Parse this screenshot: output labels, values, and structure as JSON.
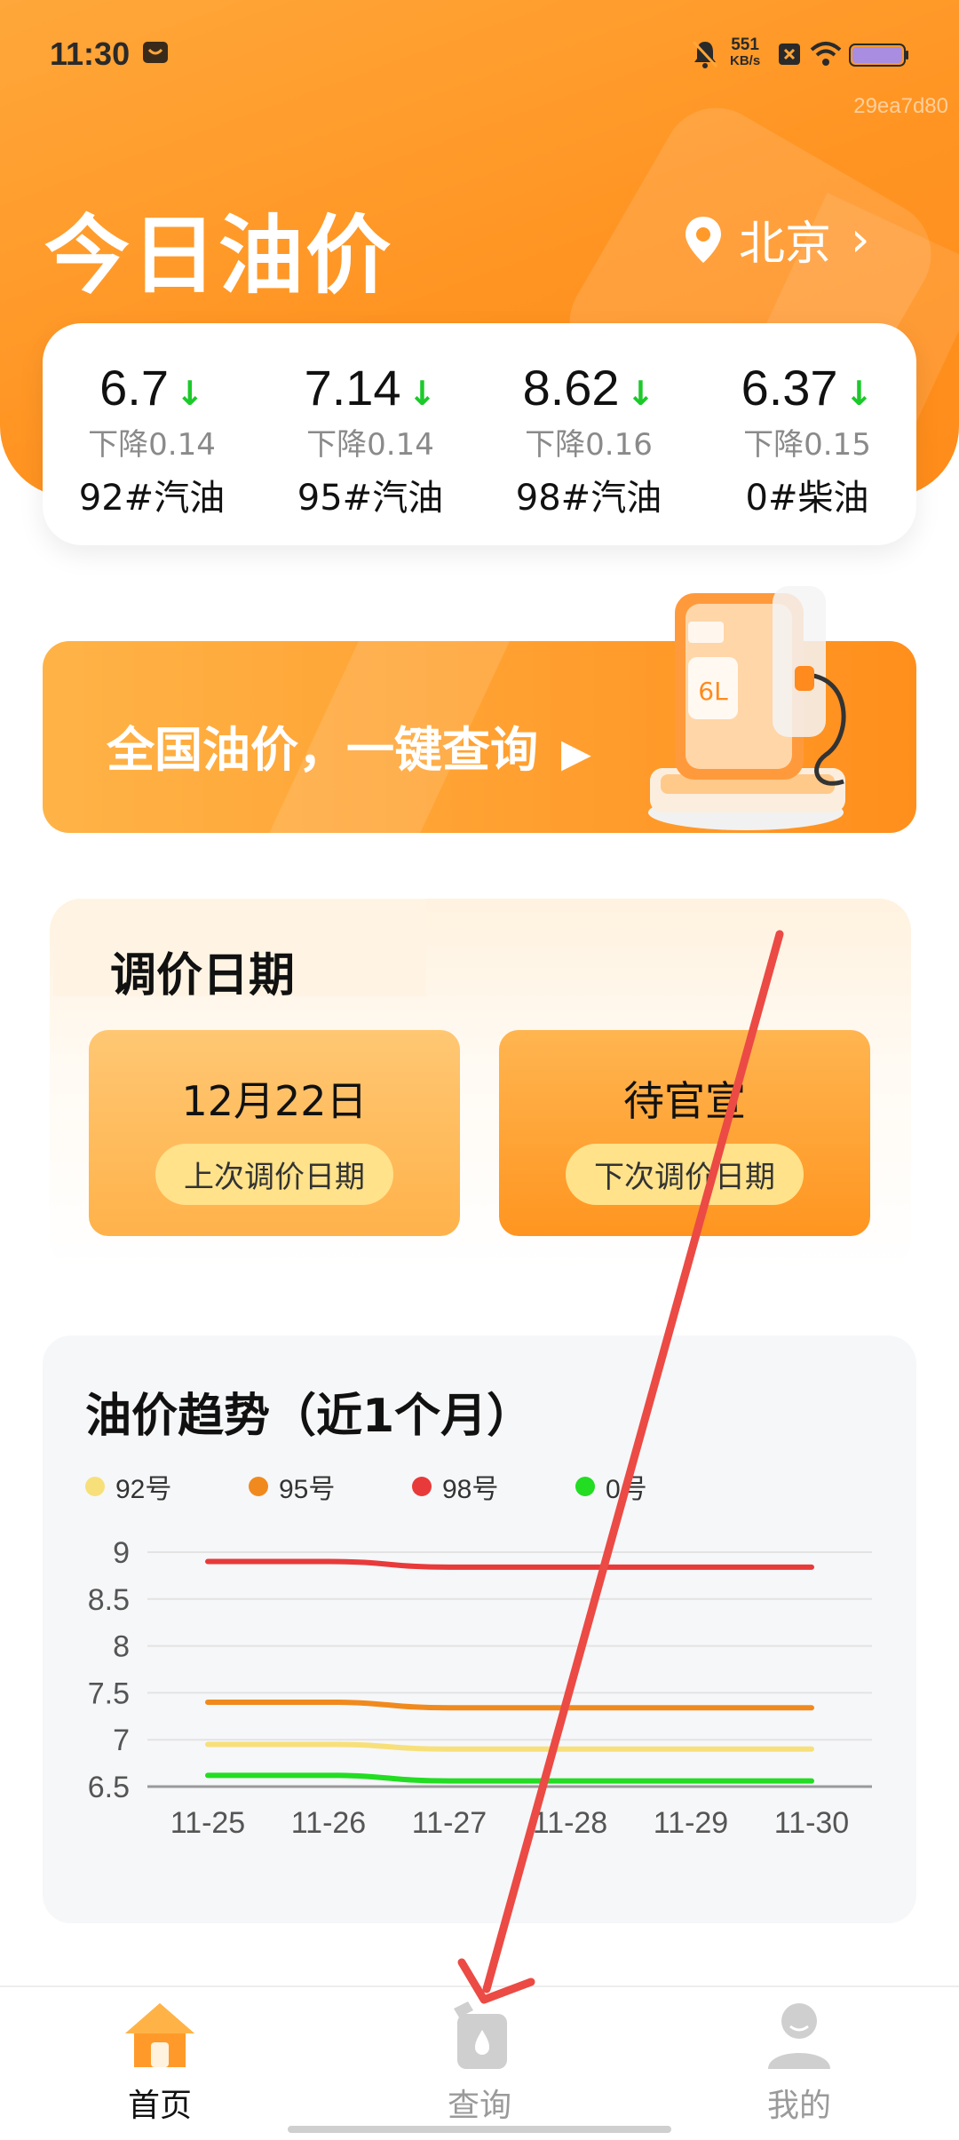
{
  "status_bar": {
    "time": "11:30",
    "net_speed_value": "551",
    "net_speed_unit": "KB/s",
    "watermark": "29ea7d80"
  },
  "header": {
    "title": "今日油价",
    "city": "北京"
  },
  "prices": [
    {
      "value": "6.7",
      "change": "下降0.14",
      "name": "92#汽油",
      "direction": "down"
    },
    {
      "value": "7.14",
      "change": "下降0.14",
      "name": "95#汽油",
      "direction": "down"
    },
    {
      "value": "8.62",
      "change": "下降0.16",
      "name": "98#汽油",
      "direction": "down"
    },
    {
      "value": "6.37",
      "change": "下降0.15",
      "name": "0#柴油",
      "direction": "down"
    }
  ],
  "banner": {
    "text": "全国油价，一键查询",
    "pump_label": "6L"
  },
  "adjust": {
    "title": "调价日期",
    "last": {
      "date": "12月22日",
      "label": "上次调价日期"
    },
    "next": {
      "date": "待官宣",
      "label": "下次调价日期"
    }
  },
  "trend": {
    "title": "油价趋势（近1个月）"
  },
  "chart_data": {
    "type": "line",
    "title": "油价趋势（近1个月）",
    "x": [
      "11-25",
      "11-26",
      "11-27",
      "11-28",
      "11-29",
      "11-30"
    ],
    "ylim": [
      6.5,
      9
    ],
    "yticks": [
      "9",
      "8.5",
      "8",
      "7.5",
      "7",
      "6.5"
    ],
    "grid": true,
    "legend_position": "top-left",
    "series": [
      {
        "name": "92号",
        "color": "#f7e07a",
        "values": [
          6.95,
          6.95,
          6.9,
          6.9,
          6.9,
          6.9
        ]
      },
      {
        "name": "95号",
        "color": "#f08a1e",
        "values": [
          7.4,
          7.4,
          7.34,
          7.34,
          7.34,
          7.34
        ]
      },
      {
        "name": "98号",
        "color": "#e83a3a",
        "values": [
          8.9,
          8.9,
          8.84,
          8.84,
          8.84,
          8.84
        ]
      },
      {
        "name": "0号",
        "color": "#22dd22",
        "values": [
          6.62,
          6.62,
          6.56,
          6.56,
          6.56,
          6.56
        ]
      }
    ]
  },
  "tabbar": {
    "home": "首页",
    "query": "查询",
    "mine": "我的"
  },
  "colors": {
    "accent": "#ff9422",
    "down": "#1cc92a",
    "annotation_arrow": "#ec4a44"
  }
}
